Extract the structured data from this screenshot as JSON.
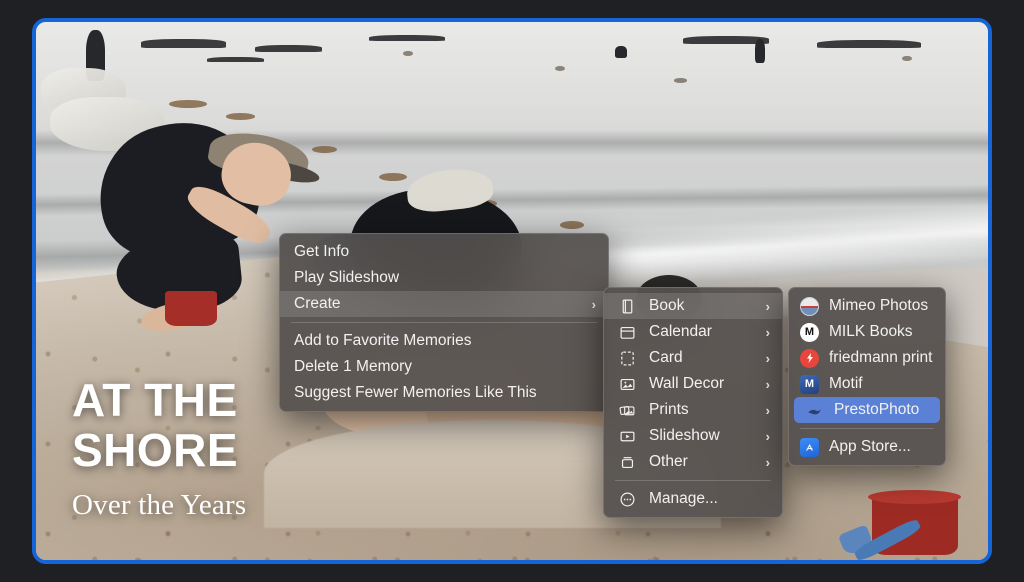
{
  "window": {
    "selection_border_color": "#1565d8",
    "background_color": "#1e2024"
  },
  "photo": {
    "description": "Beach scene with two children playing in the sand at the shoreline",
    "overlay": {
      "title_line_1": "AT THE",
      "title_line_2": "SHORE",
      "subtitle": "Over the Years"
    }
  },
  "menus": {
    "primary": {
      "items": [
        {
          "label": "Get Info",
          "type": "item",
          "selected": false,
          "submenu": false
        },
        {
          "label": "Play Slideshow",
          "type": "item",
          "selected": false,
          "submenu": false
        },
        {
          "label": "Create",
          "type": "item",
          "selected": true,
          "submenu": true,
          "chevron": "›"
        },
        {
          "label": "",
          "type": "separator"
        },
        {
          "label": "Add to Favorite Memories",
          "type": "item",
          "selected": false,
          "submenu": false
        },
        {
          "label": "Delete 1 Memory",
          "type": "item",
          "selected": false,
          "submenu": false
        },
        {
          "label": "Suggest Fewer Memories Like This",
          "type": "item",
          "selected": false,
          "submenu": false
        }
      ]
    },
    "create": {
      "items": [
        {
          "label": "Book",
          "icon": "book-icon",
          "type": "item",
          "selected": true,
          "submenu": true,
          "chevron": "›"
        },
        {
          "label": "Calendar",
          "icon": "calendar-icon",
          "type": "item",
          "selected": false,
          "submenu": true,
          "chevron": "›"
        },
        {
          "label": "Card",
          "icon": "card-icon",
          "type": "item",
          "selected": false,
          "submenu": true,
          "chevron": "›"
        },
        {
          "label": "Wall Decor",
          "icon": "photo-frame-icon",
          "type": "item",
          "selected": false,
          "submenu": true,
          "chevron": "›"
        },
        {
          "label": "Prints",
          "icon": "prints-icon",
          "type": "item",
          "selected": false,
          "submenu": true,
          "chevron": "›"
        },
        {
          "label": "Slideshow",
          "icon": "play-box-icon",
          "type": "item",
          "selected": false,
          "submenu": true,
          "chevron": "›"
        },
        {
          "label": "Other",
          "icon": "tray-icon",
          "type": "item",
          "selected": false,
          "submenu": true,
          "chevron": "›"
        },
        {
          "label": "",
          "type": "separator"
        },
        {
          "label": "Manage...",
          "icon": "ellipsis-circle-icon",
          "type": "item",
          "selected": false,
          "submenu": false
        }
      ]
    },
    "apps": {
      "items": [
        {
          "label": "Mimeo Photos",
          "icon": "mimeo-photos-app-icon",
          "type": "item",
          "selected": false,
          "icon_color": "#e8e8e8",
          "icon_text": ""
        },
        {
          "label": "MILK Books",
          "icon": "milk-books-app-icon",
          "type": "item",
          "selected": false,
          "icon_color": "#ffffff",
          "icon_text": "M"
        },
        {
          "label": "friedmann print",
          "icon": "friedmann-print-app-icon",
          "type": "item",
          "selected": false,
          "icon_color": "#e8453c",
          "icon_text": "⚡"
        },
        {
          "label": "Motif",
          "icon": "motif-app-icon",
          "type": "item",
          "selected": false,
          "icon_color": "#2e57a8",
          "icon_text": "M"
        },
        {
          "label": "PrestoPhoto",
          "icon": "prestophoto-app-icon",
          "type": "item",
          "selected": true,
          "icon_color": "#5b81d7",
          "icon_text": ""
        },
        {
          "label": "",
          "type": "separator"
        },
        {
          "label": "App Store...",
          "icon": "app-store-icon",
          "type": "item",
          "selected": false,
          "icon_color": "#2d7ff2",
          "icon_text": "A"
        }
      ]
    }
  },
  "colors": {
    "menu_background": "rgba(84,80,78,.93)",
    "menu_text": "#f2f1f0",
    "highlight_blue": "#5b81d7",
    "highlight_grey": "rgba(255,255,255,.13)"
  }
}
